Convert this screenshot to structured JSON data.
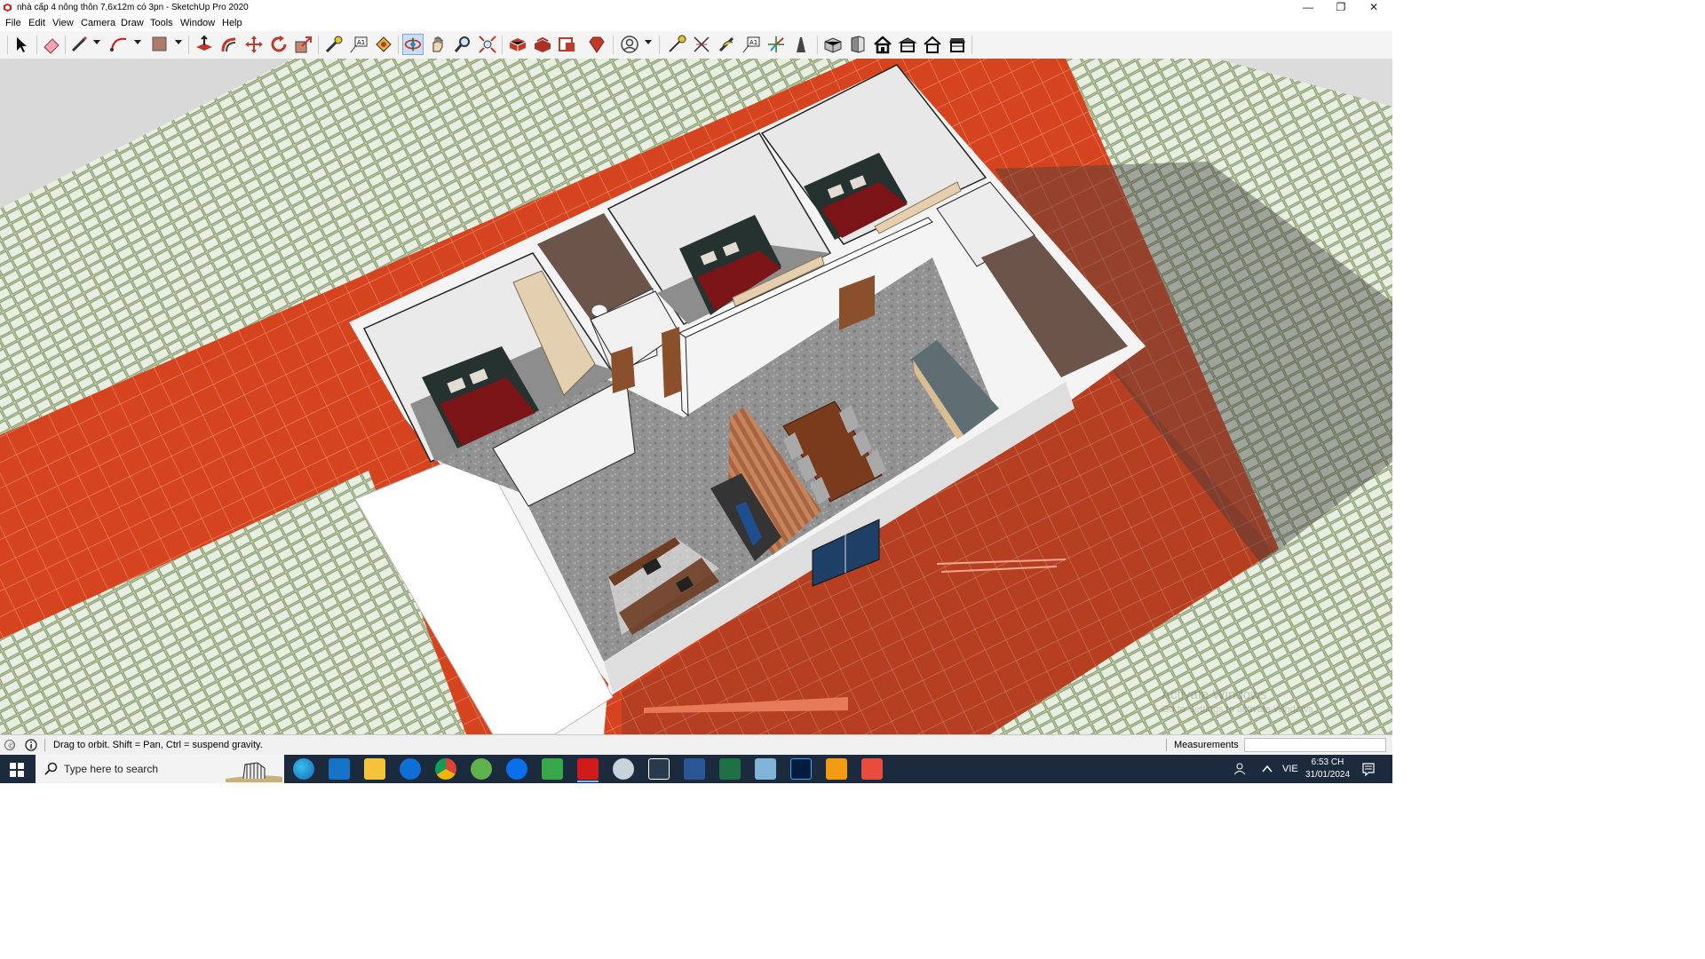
{
  "window": {
    "title": "nhà cấp 4 nông thôn 7,6x12m có 3pn - SketchUp Pro 2020",
    "icon": "sketchup-logo-icon",
    "buttons": [
      "minimize-icon",
      "restore-icon",
      "close-icon"
    ]
  },
  "menu": [
    "File",
    "Edit",
    "View",
    "Camera",
    "Draw",
    "Tools",
    "Window",
    "Help"
  ],
  "toolbar": {
    "tools": [
      "select-icon",
      "eraser-icon",
      "pencil-line-icon",
      "arc-icon",
      "rectangle-icon",
      "push-pull-icon",
      "offset-icon",
      "move-icon",
      "rotate-icon",
      "scale-icon",
      "tape-measure-icon",
      "text-icon",
      "paint-bucket-icon",
      "orbit-icon",
      "pan-icon",
      "zoom-icon",
      "zoom-extents-icon",
      "3d-warehouse-icon",
      "extension-warehouse-icon",
      "layout-icon",
      "extension-manager-icon",
      "profile-icon",
      "dimension-icon",
      "protractor-icon",
      "axes-icon",
      "3d-text-icon",
      "section-plane-icon",
      "walk-icon",
      "iso-view-icon",
      "front-view-icon",
      "top-view-icon",
      "right-view-icon",
      "back-view-icon",
      "left-view-icon"
    ],
    "active_tool": "orbit-icon"
  },
  "status": {
    "hint": "Drag to orbit. Shift = Pan, Ctrl = suspend gravity.",
    "measurements_label": "Measurements",
    "measurements_value": ""
  },
  "taskbar": {
    "search_placeholder": "Type here to search",
    "apps": [
      "edge-icon",
      "outlook-icon",
      "file-explorer-icon",
      "teamviewer-icon",
      "chrome-icon",
      "cc-cleaner-icon",
      "zalo-icon",
      "camtasia-icon",
      "sketchup-icon",
      "sync-icon",
      "paint-icon",
      "word-icon",
      "excel-icon",
      "mail-icon",
      "photoshop-icon",
      "amz-icon",
      "camtasia-recorder-icon"
    ],
    "lang": "VIE",
    "time": "6:53 CH",
    "date": "31/01/2024"
  },
  "watermark": {
    "line1": "Activate Windows",
    "line2": "Go to Settings to activate Windows."
  },
  "colors": {
    "floor_tile": "#d2431f",
    "grass_pavers": "#cbd6c0",
    "wall": "#ffffff",
    "bed": "#7a1417",
    "headboard": "#263230",
    "interior_floor": "#8f8f8f",
    "taskbar": "#1b2b3d"
  }
}
